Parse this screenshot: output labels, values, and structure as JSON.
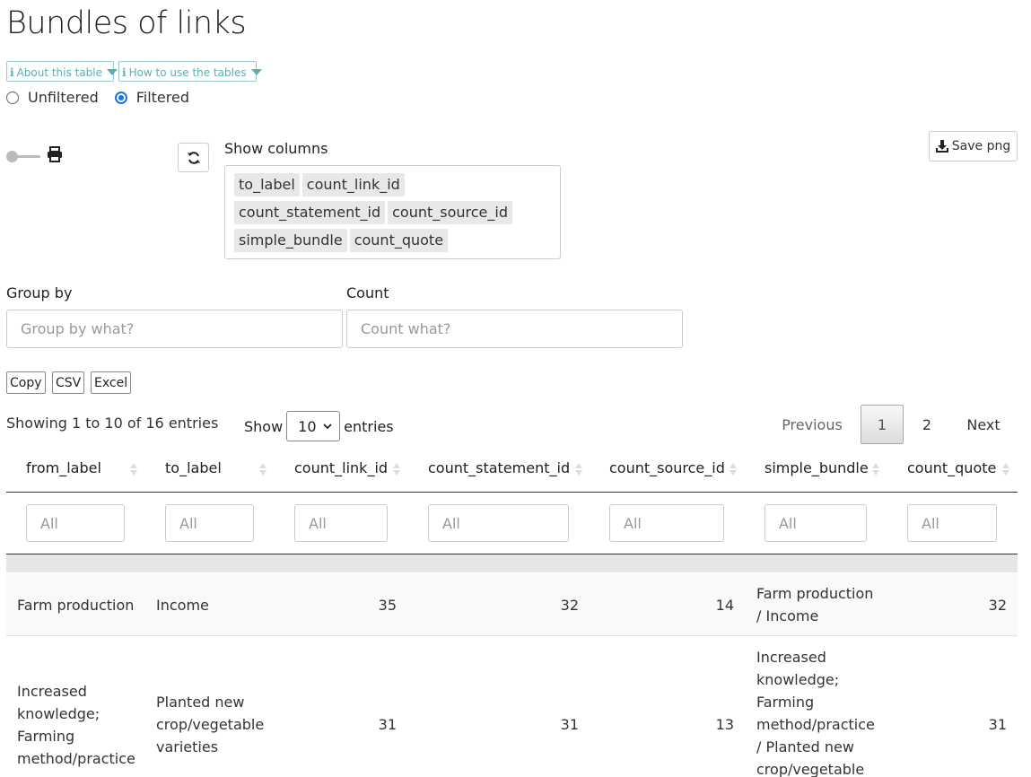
{
  "page": {
    "title": "Bundles of links"
  },
  "toolbar": {
    "about_label": "About this table",
    "howto_label": "How to use the tables",
    "radio_unfiltered": "Unfiltered",
    "radio_filtered": "Filtered",
    "selected_radio": "Filtered",
    "show_columns_label": "Show columns",
    "save_png_label": "Save png"
  },
  "columns_selected": [
    "to_label",
    "count_link_id",
    "count_statement_id",
    "count_source_id",
    "simple_bundle",
    "count_quote"
  ],
  "group": {
    "label": "Group by",
    "placeholder": "Group by what?"
  },
  "count": {
    "label": "Count",
    "placeholder": "Count what?"
  },
  "export": {
    "copy": "Copy",
    "csv": "CSV",
    "excel": "Excel"
  },
  "table_info": {
    "showing": "Showing 1 to 10 of 16 entries",
    "show_label": "Show",
    "entries_label": "entries",
    "page_length": "10"
  },
  "pagination": {
    "previous": "Previous",
    "pages": [
      "1",
      "2"
    ],
    "current": "1",
    "next": "Next"
  },
  "table": {
    "headers": [
      "from_label",
      "to_label",
      "count_link_id",
      "count_statement_id",
      "count_source_id",
      "simple_bundle",
      "count_quote"
    ],
    "filter_placeholder": "All",
    "rows": [
      {
        "from_label": [
          "Farm production"
        ],
        "to_label": [
          "Income"
        ],
        "count_link_id": "35",
        "count_statement_id": "32",
        "count_source_id": "14",
        "simple_bundle": [
          "Farm production",
          "/ Income"
        ],
        "count_quote": "32"
      },
      {
        "from_label": [
          "Increased",
          "knowledge;",
          "Farming",
          "method/practice"
        ],
        "to_label": [
          "Planted new",
          "crop/vegetable",
          "varieties"
        ],
        "count_link_id": "31",
        "count_statement_id": "31",
        "count_source_id": "13",
        "simple_bundle": [
          "Increased",
          "knowledge;",
          "Farming",
          "method/practice",
          "/ Planted new",
          "crop/vegetable"
        ],
        "count_quote": "31"
      }
    ]
  }
}
